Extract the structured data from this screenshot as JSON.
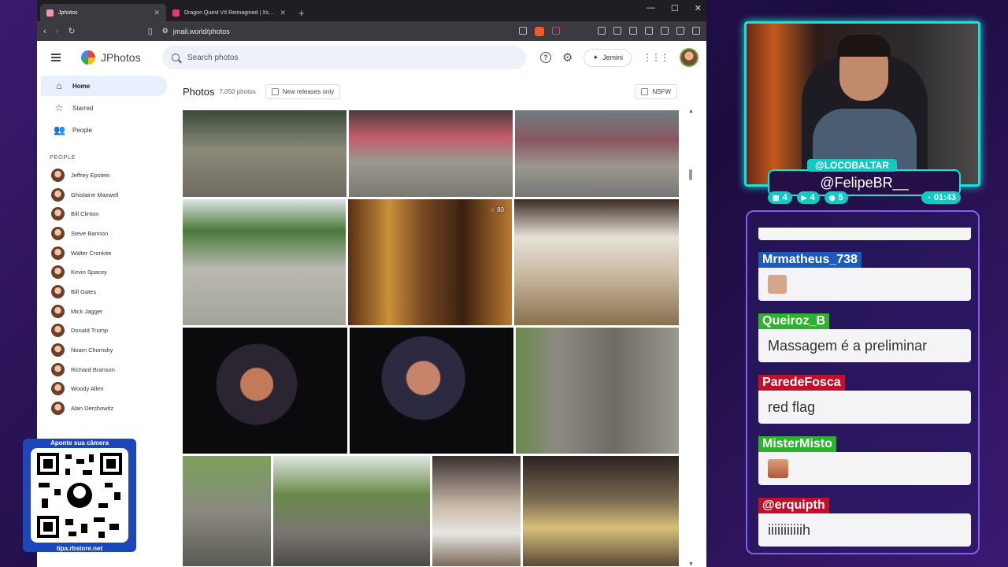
{
  "browser": {
    "tabs": [
      {
        "label": "Jphotos",
        "active": true
      },
      {
        "label": "Dragon Quest VII Reimagined | Xsolla Partner",
        "active": false
      }
    ],
    "url": "jmail.world/photos"
  },
  "app": {
    "name": "JPhotos",
    "search_placeholder": "Search photos",
    "gemini_label": "Jemini"
  },
  "sidebar": {
    "nav": [
      {
        "label": "Home",
        "icon": "home-icon",
        "active": true
      },
      {
        "label": "Starred",
        "icon": "star-icon",
        "active": false
      },
      {
        "label": "People",
        "icon": "people-icon",
        "active": false
      }
    ],
    "people_header": "PEOPLE",
    "people": [
      "Jeffrey Epstein",
      "Ghislaine Maxwell",
      "Bill Clinton",
      "Steve Bannon",
      "Walter Cronkite",
      "Kevin Spacey",
      "Bill Gates",
      "Mick Jagger",
      "Donald Trump",
      "Noam Chomsky",
      "Richard Branson",
      "Woody Allen",
      "Alan Dershowitz"
    ]
  },
  "main": {
    "title": "Photos",
    "count": "7,050 photos",
    "new_releases_label": "New releases only",
    "nsfw_label": "NSFW",
    "star_count": "80"
  },
  "overlay": {
    "handle_top": "@LOCOBALTAR",
    "handle_main": "@FelipeBR__",
    "badges": [
      "4",
      "4",
      "5"
    ],
    "timer": "01:43",
    "chat": [
      {
        "user": "Mrmatheus_738",
        "color": "#1e5bb8",
        "text": "",
        "emote": true
      },
      {
        "user": "Queiroz_B",
        "color": "#2fb12f",
        "text": "Massagem é a preliminar",
        "emote": false
      },
      {
        "user": "ParedeFosca",
        "color": "#c0102a",
        "text": "red flag",
        "emote": false
      },
      {
        "user": "MisterMisto",
        "color": "#2fb12f",
        "text": "",
        "emote": true
      },
      {
        "user": "@erquipth",
        "color": "#c0102a",
        "text": "iiiiiiiiiiih",
        "emote": false
      }
    ],
    "qr_top": "Aponte sua câmera",
    "qr_bottom": "tipa.rbstore.net"
  },
  "colors": {
    "accent": "#19e0d8",
    "selected_nav": "#e8f0fe"
  }
}
